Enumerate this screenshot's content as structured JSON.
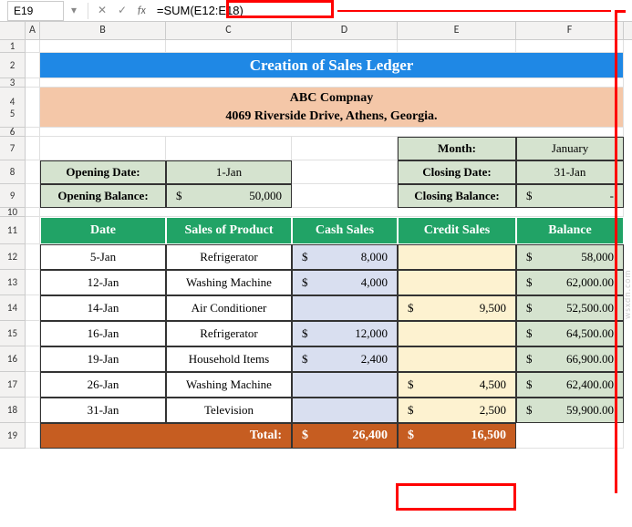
{
  "formula_bar": {
    "cell_ref": "E19",
    "fx": "fx",
    "formula": "=SUM(E12:E18)"
  },
  "columns": [
    "A",
    "B",
    "C",
    "D",
    "E",
    "F"
  ],
  "rows": [
    "1",
    "2",
    "3",
    "4",
    "5",
    "6",
    "7",
    "8",
    "9",
    "10",
    "11",
    "12",
    "13",
    "14",
    "15",
    "16",
    "17",
    "18",
    "19"
  ],
  "title": "Creation of Sales Ledger",
  "company": {
    "name": "ABC Compnay",
    "address": "4069 Riverside Drive, Athens, Georgia."
  },
  "summary": {
    "month_label": "Month:",
    "month": "January",
    "opening_date_label": "Opening Date:",
    "opening_date": "1-Jan",
    "closing_date_label": "Closing Date:",
    "closing_date": "31-Jan",
    "opening_bal_label": "Opening Balance:",
    "opening_bal_sym": "$",
    "opening_bal": "50,000",
    "closing_bal_label": "Closing Balance:",
    "closing_bal_sym": "$",
    "closing_bal": "-"
  },
  "headers": {
    "date": "Date",
    "product": "Sales of Product",
    "cash": "Cash Sales",
    "credit": "Credit Sales",
    "balance": "Balance"
  },
  "ledger": [
    {
      "date": "5-Jan",
      "product": "Refrigerator",
      "cash_sym": "$",
      "cash": "8,000",
      "credit_sym": "",
      "credit": "",
      "bal_sym": "$",
      "bal": "58,000"
    },
    {
      "date": "12-Jan",
      "product": "Washing Machine",
      "cash_sym": "$",
      "cash": "4,000",
      "credit_sym": "",
      "credit": "",
      "bal_sym": "$",
      "bal": "62,000.00"
    },
    {
      "date": "14-Jan",
      "product": "Air Conditioner",
      "cash_sym": "",
      "cash": "",
      "credit_sym": "$",
      "credit": "9,500",
      "bal_sym": "$",
      "bal": "52,500.00"
    },
    {
      "date": "16-Jan",
      "product": "Refrigerator",
      "cash_sym": "$",
      "cash": "12,000",
      "credit_sym": "",
      "credit": "",
      "bal_sym": "$",
      "bal": "64,500.00"
    },
    {
      "date": "19-Jan",
      "product": "Household Items",
      "cash_sym": "$",
      "cash": "2,400",
      "credit_sym": "",
      "credit": "",
      "bal_sym": "$",
      "bal": "66,900.00"
    },
    {
      "date": "26-Jan",
      "product": "Washing Machine",
      "cash_sym": "",
      "cash": "",
      "credit_sym": "$",
      "credit": "4,500",
      "bal_sym": "$",
      "bal": "62,400.00"
    },
    {
      "date": "31-Jan",
      "product": "Television",
      "cash_sym": "",
      "cash": "",
      "credit_sym": "$",
      "credit": "2,500",
      "bal_sym": "$",
      "bal": "59,900.00"
    }
  ],
  "totals": {
    "label": "Total:",
    "cash_sym": "$",
    "cash": "26,400",
    "credit_sym": "$",
    "credit": "16,500"
  },
  "watermark": "wsxdn.com",
  "chart_data": {
    "type": "table",
    "title": "Creation of Sales Ledger",
    "columns": [
      "Date",
      "Sales of Product",
      "Cash Sales",
      "Credit Sales",
      "Balance"
    ],
    "rows": [
      [
        "5-Jan",
        "Refrigerator",
        8000,
        null,
        58000
      ],
      [
        "12-Jan",
        "Washing Machine",
        4000,
        null,
        62000
      ],
      [
        "14-Jan",
        "Air Conditioner",
        null,
        9500,
        52500
      ],
      [
        "16-Jan",
        "Refrigerator",
        12000,
        null,
        64500
      ],
      [
        "19-Jan",
        "Household Items",
        2400,
        null,
        66900
      ],
      [
        "26-Jan",
        "Washing Machine",
        null,
        4500,
        62400
      ],
      [
        "31-Jan",
        "Television",
        null,
        2500,
        59900
      ]
    ],
    "totals": {
      "Cash Sales": 26400,
      "Credit Sales": 16500
    }
  }
}
